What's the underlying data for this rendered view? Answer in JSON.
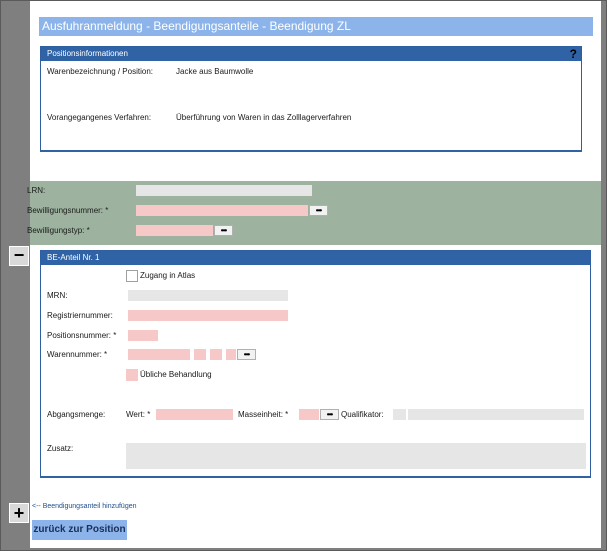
{
  "title": "Ausfuhranmeldung - Beendigungsanteile - Beendigung ZL",
  "position_info": {
    "header": "Positionsinformationen",
    "help": "?",
    "rows": [
      {
        "label": "Warenbezeichnung / Position:",
        "value": "Jacke aus Baumwolle"
      },
      {
        "label": "Vorangegangenes Verfahren:",
        "value": "Überführung von Waren in das Zolllagerverfahren"
      }
    ]
  },
  "header_fields": {
    "lrn_label": "LRN:",
    "bewilligungsnummer_label": "Bewilligungsnummer: *",
    "bewilligungstyp_label": "Bewilligungstyp: *",
    "lookup": "•••"
  },
  "be_anteil": {
    "header": "BE-Anteil Nr.   1",
    "zugang_label": "Zugang in Atlas",
    "mrn_label": "MRN:",
    "registriernummer_label": "Registriernummer:",
    "positionsnummer_label": "Positionsnummer: *",
    "warennummer_label": "Warennummer: *",
    "uebliche_label": "Übliche Behandlung",
    "abgangsmenge_label": "Abgangsmenge:",
    "wert_label": "Wert: *",
    "masseinheit_label": "Masseinheit: *",
    "qualifikator_label": "Qualifikator:",
    "zusatz_label": "Zusatz:",
    "lookup": "•••"
  },
  "controls": {
    "collapse": "−",
    "add": "+",
    "add_link": "<-- Beendigungsanteil hinzufügen",
    "back_button": "zurück zur Position"
  },
  "colors": {
    "title_bg": "#8cb4ea",
    "panel_head": "#2f63a6",
    "green_band": "#9db39f",
    "required_field": "#f7c8c8",
    "optional_field": "#e6e6e6"
  }
}
